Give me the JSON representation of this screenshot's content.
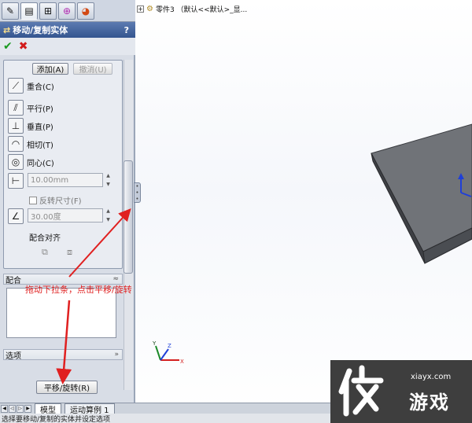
{
  "panel": {
    "tab_icons": [
      "feature-tree-icon",
      "property-manager-icon",
      "configuration-manager-icon",
      "dimxpert-icon",
      "display-manager-icon"
    ],
    "title": "移动/复制实体",
    "help": "?",
    "ok_glyph": "✔",
    "cancel_glyph": "✖",
    "add_button": "添加(A)",
    "cancel_add_button": "撤消(U)",
    "mates": [
      {
        "icon": "coincident-icon",
        "label": "重合(C)"
      },
      {
        "icon": "parallel-icon",
        "label": "平行(P)"
      },
      {
        "icon": "perpendicular-icon",
        "label": "垂直(P)"
      },
      {
        "icon": "tangent-icon",
        "label": "相切(T)"
      },
      {
        "icon": "concentric-icon",
        "label": "同心(C)"
      }
    ],
    "distance_value": "10.00mm",
    "flip_dimension": "反转尺寸(F)",
    "angle_value": "30.00度",
    "alignment_label": "配合对齐",
    "mate_section": "配合",
    "options_section": "选项",
    "translate_rotate_button": "平移/旋转(R)"
  },
  "bottom": {
    "tab_model": "模型",
    "tab_motion": "运动算例 1",
    "status": "选择要移动/复制的实体并设定选项"
  },
  "viewport": {
    "tree_item": "零件3 （默认<<默认>_显..."
  },
  "annotation": {
    "text": "拖动下拉条，点击平移/旋转"
  },
  "triad": {
    "x": "X",
    "y": "Y",
    "z": "Z"
  },
  "watermark": {
    "url": "xiayx.com",
    "text": "游戏"
  },
  "colors": {
    "title_bar": "#34558f",
    "annotation": "#e02020",
    "body_dark": "#4a4d52",
    "body_top": "#707378"
  }
}
